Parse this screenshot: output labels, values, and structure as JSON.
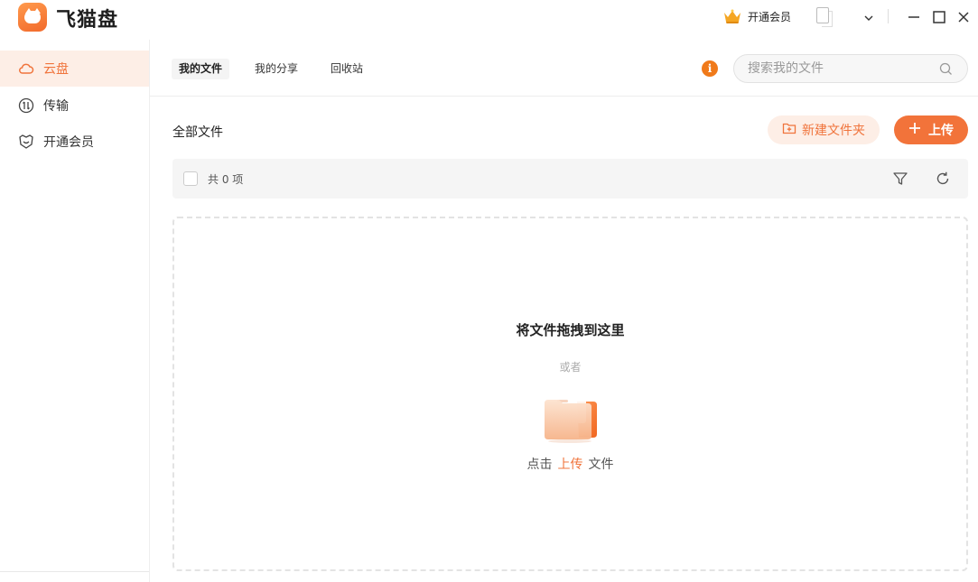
{
  "app": {
    "name": "飞猫盘"
  },
  "titlebar": {
    "vip_label": "开通会员"
  },
  "sidebar": {
    "items": [
      {
        "label": "云盘",
        "icon": "cloud-icon",
        "active": true
      },
      {
        "label": "传输",
        "icon": "transfer-icon",
        "active": false
      },
      {
        "label": "开通会员",
        "icon": "membership-icon",
        "active": false
      }
    ]
  },
  "tabs": [
    {
      "label": "我的文件",
      "active": true
    },
    {
      "label": "我的分享",
      "active": false
    },
    {
      "label": "回收站",
      "active": false
    }
  ],
  "info_glyph": "i",
  "search": {
    "placeholder": "搜索我的文件",
    "value": ""
  },
  "content": {
    "heading": "全部文件",
    "new_folder_label": "新建文件夹",
    "upload_label": "上传",
    "count_text": "共 0 项"
  },
  "dropzone": {
    "title": "将文件拖拽到这里",
    "or_text": "或者",
    "prefix": "点击",
    "link": "上传",
    "suffix": "文件"
  },
  "colors": {
    "accent": "#f2733a",
    "accent_light": "#fdeee6",
    "info": "#f07a1a"
  }
}
